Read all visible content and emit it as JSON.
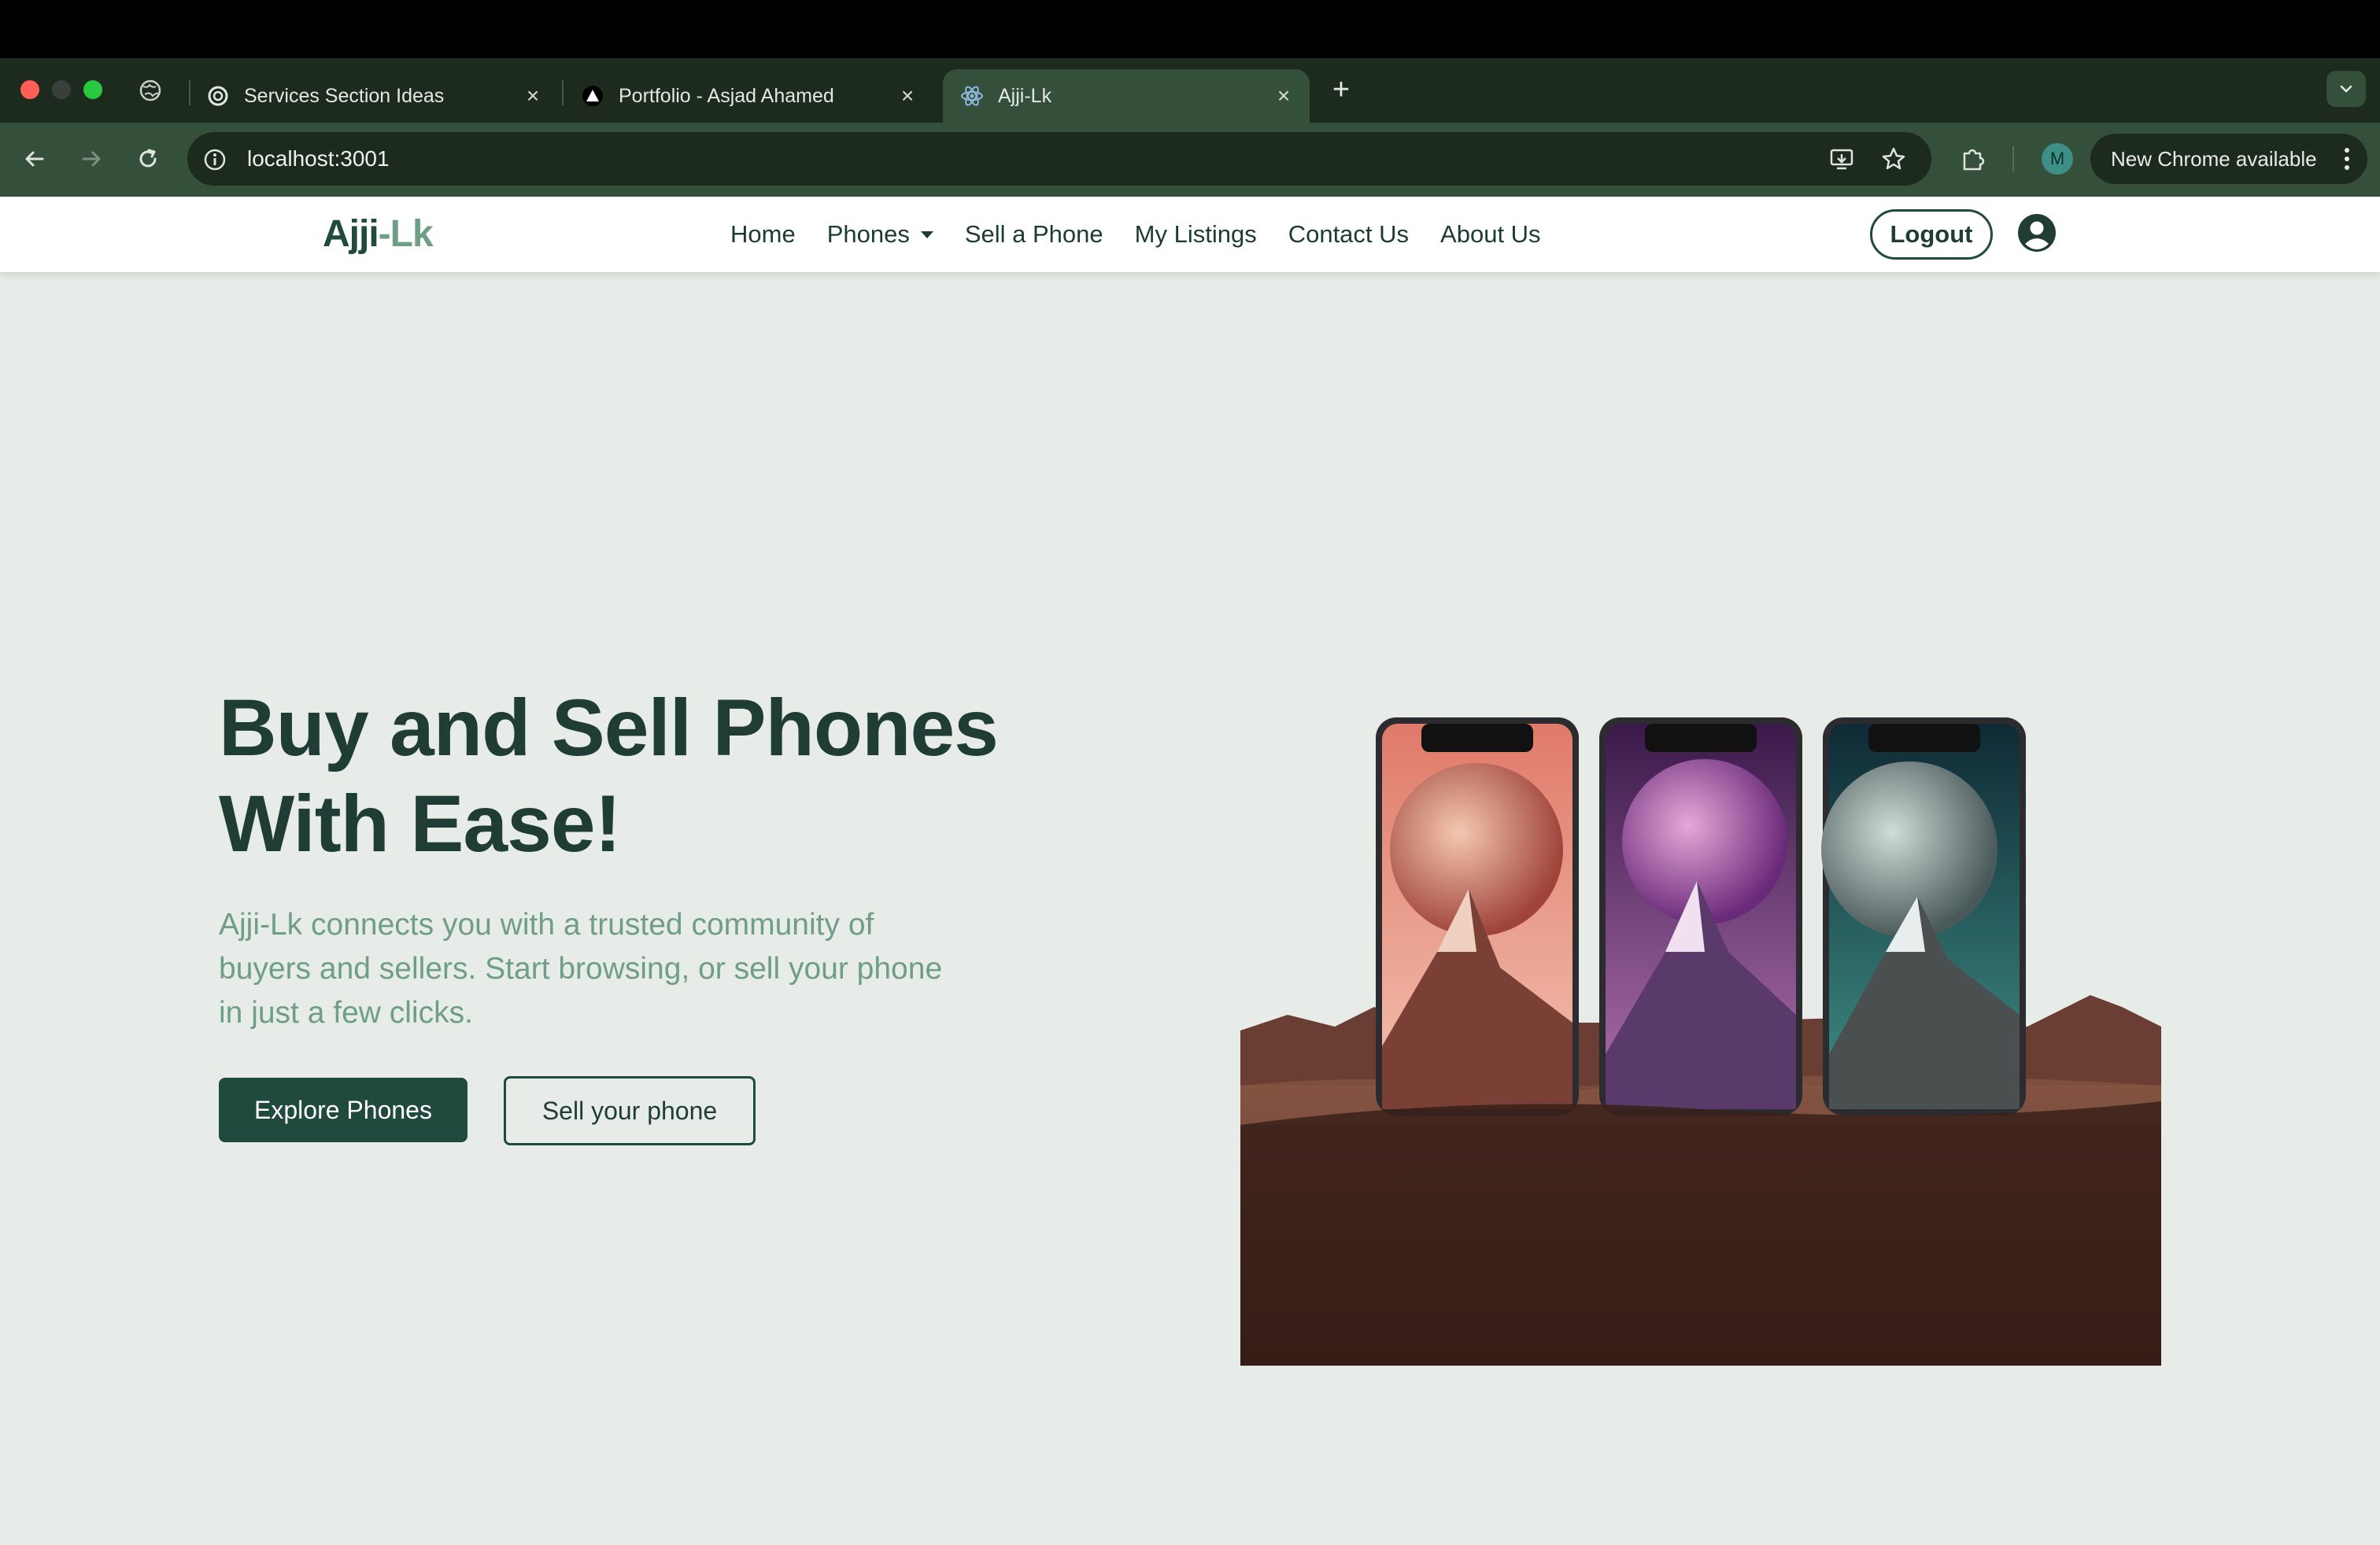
{
  "browser": {
    "tabs": [
      {
        "title": "Services Section Ideas",
        "icon": "openai-icon",
        "active": false
      },
      {
        "title": "Portfolio - Asjad Ahamed",
        "icon": "triangle-icon",
        "active": false
      },
      {
        "title": "Ajji-Lk",
        "icon": "react-icon",
        "active": true
      }
    ],
    "new_tab_label": "+",
    "url": "localhost:3001",
    "profile_initial": "M",
    "update_label": "New Chrome available"
  },
  "site": {
    "logo_main": "Ajji",
    "logo_dash": "-",
    "logo_accent": "Lk",
    "nav": {
      "home": "Home",
      "phones": "Phones",
      "sell": "Sell a Phone",
      "listings": "My Listings",
      "contact": "Contact Us",
      "about": "About Us"
    },
    "logout_label": "Logout"
  },
  "hero": {
    "title_line1": "Buy and Sell Phones",
    "title_line2": "With Ease!",
    "description": "Ajji-Lk connects you with a trusted community of buyers and sellers. Start browsing, or sell your phone in just a few clicks.",
    "primary_button": "Explore Phones",
    "secondary_button": "Sell your phone"
  },
  "colors": {
    "brand_dark": "#1f4a3d",
    "brand_light": "#6f9e86",
    "page_bg": "#e8ece8"
  }
}
